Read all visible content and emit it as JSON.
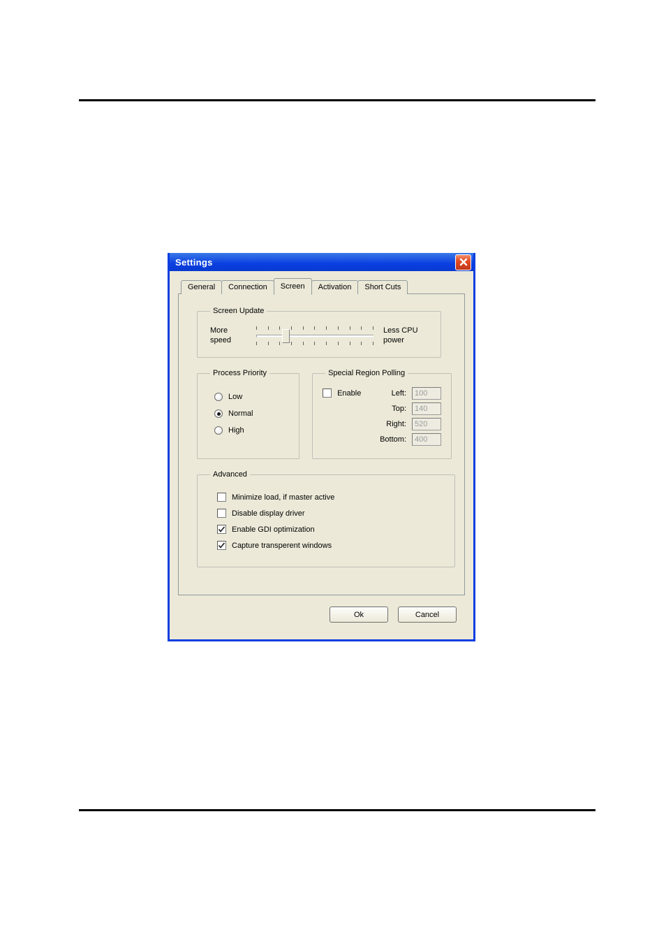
{
  "dialog": {
    "title": "Settings"
  },
  "tabs": {
    "items": [
      {
        "label": "General"
      },
      {
        "label": "Connection"
      },
      {
        "label": "Screen"
      },
      {
        "label": "Activation"
      },
      {
        "label": "Short Cuts"
      }
    ],
    "active_index": 2
  },
  "screen_update": {
    "legend": "Screen Update",
    "left_label_line1": "More",
    "left_label_line2": "speed",
    "right_label_line1": "Less CPU",
    "right_label_line2": "power",
    "slider_ticks": 11,
    "slider_pos_percent": 22
  },
  "process_priority": {
    "legend": "Process Priority",
    "options": [
      {
        "label": "Low",
        "checked": false
      },
      {
        "label": "Normal",
        "checked": true
      },
      {
        "label": "High",
        "checked": false
      }
    ]
  },
  "special_region_polling": {
    "legend": "Special Region Polling",
    "enable_label": "Enable",
    "enable_checked": false,
    "fields": {
      "left": {
        "label": "Left:",
        "value": "100"
      },
      "top": {
        "label": "Top:",
        "value": "140"
      },
      "right": {
        "label": "Right:",
        "value": "520"
      },
      "bottom": {
        "label": "Bottom:",
        "value": "400"
      }
    }
  },
  "advanced": {
    "legend": "Advanced",
    "items": [
      {
        "label": "Minimize load, if master active",
        "checked": false
      },
      {
        "label": "Disable display driver",
        "checked": false
      },
      {
        "label": "Enable GDI optimization",
        "checked": true
      },
      {
        "label": "Capture transperent windows",
        "checked": true
      }
    ]
  },
  "buttons": {
    "ok": "Ok",
    "cancel": "Cancel"
  }
}
